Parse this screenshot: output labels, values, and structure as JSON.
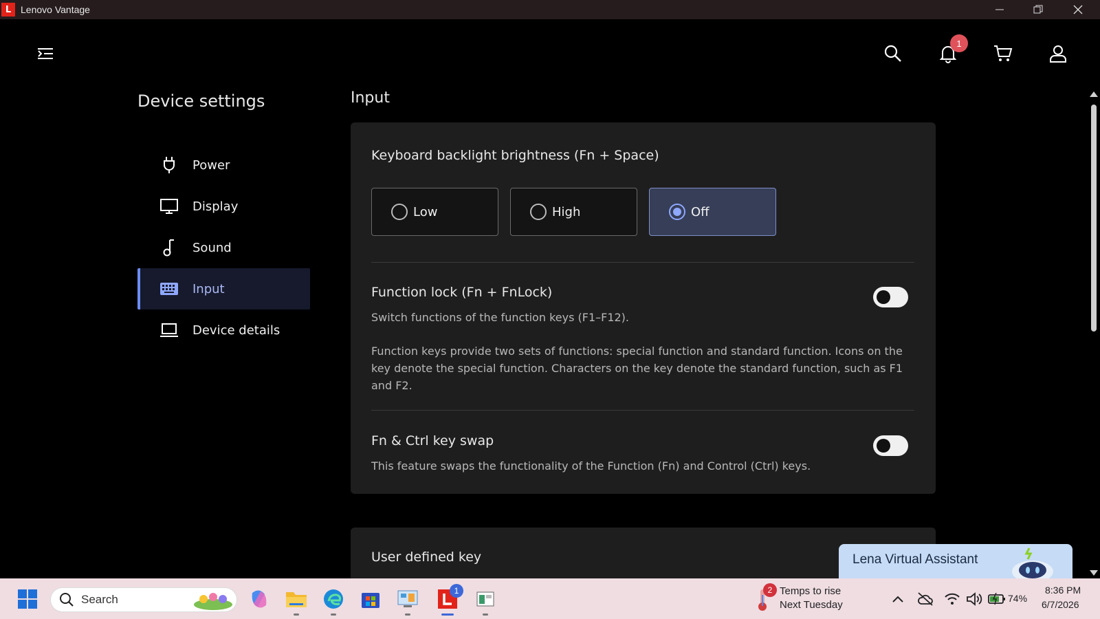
{
  "window": {
    "app_logo_letter": "L",
    "title": "Lenovo Vantage"
  },
  "header": {
    "notification_count": "1"
  },
  "sidebar": {
    "title": "Device settings",
    "items": [
      {
        "label": "Power",
        "icon": "plug-icon"
      },
      {
        "label": "Display",
        "icon": "monitor-icon"
      },
      {
        "label": "Sound",
        "icon": "music-note-icon"
      },
      {
        "label": "Input",
        "icon": "keyboard-icon",
        "active": true
      },
      {
        "label": "Device details",
        "icon": "laptop-icon"
      }
    ]
  },
  "main": {
    "section_title": "Input",
    "backlight": {
      "title": "Keyboard backlight brightness (Fn + Space)",
      "options": [
        {
          "label": "Low",
          "selected": false
        },
        {
          "label": "High",
          "selected": false
        },
        {
          "label": "Off",
          "selected": true
        }
      ]
    },
    "function_lock": {
      "title": "Function lock (Fn + FnLock)",
      "subtitle": "Switch functions of the function keys (F1–F12).",
      "description": "Function keys provide two sets of functions: special function and standard function. Icons on the key denote the special function. Characters on the key denote the standard function, such as F1 and F2.",
      "enabled": false
    },
    "fn_ctrl_swap": {
      "title": "Fn & Ctrl key swap",
      "description": "This feature swaps the functionality of the Function (Fn) and Control (Ctrl) keys.",
      "enabled": false
    },
    "user_defined_key": {
      "title": "User defined key"
    }
  },
  "assistant": {
    "label": "Lena Virtual Assistant"
  },
  "taskbar": {
    "search_label": "Search",
    "vantage_badge": "1",
    "weather": {
      "badge": "2",
      "line1": "Temps to rise",
      "line2": "Next Tuesday"
    },
    "battery_percent": "74%",
    "time": "8:36 PM",
    "date": "6/7/2026"
  },
  "colors": {
    "accent": "#6b8cf5",
    "brand_red": "#e2231a",
    "notification_badge": "#e0525a",
    "taskbar_bg": "#efdde2"
  }
}
